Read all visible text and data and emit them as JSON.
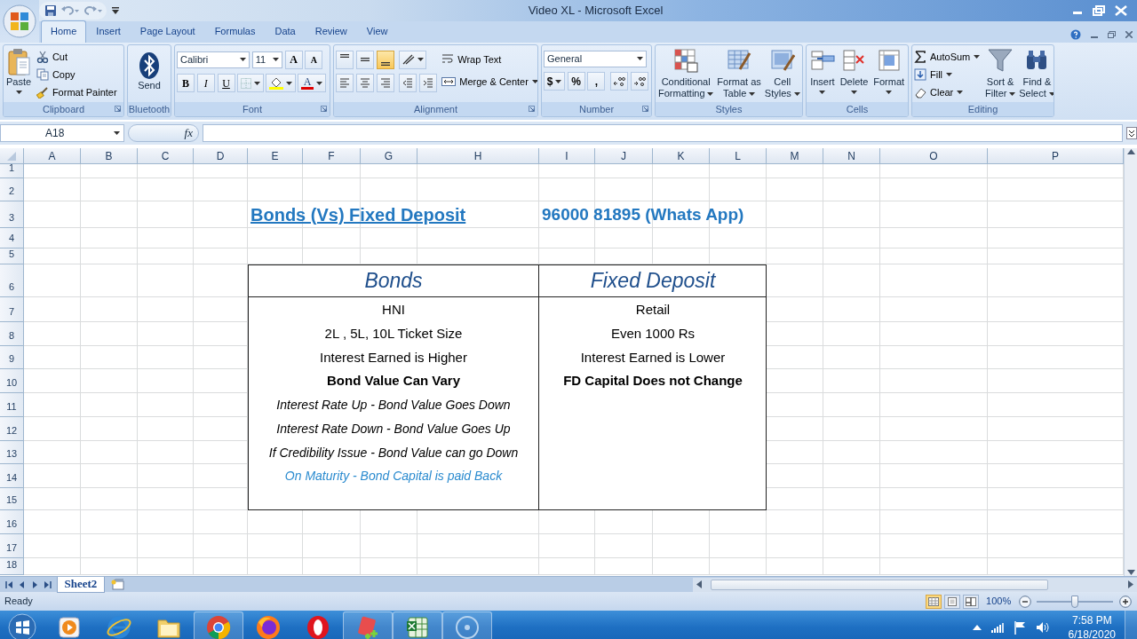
{
  "window": {
    "title": "Video XL - Microsoft Excel"
  },
  "ribbon_tabs": [
    {
      "label": "Home",
      "selected": true
    },
    {
      "label": "Insert",
      "selected": false
    },
    {
      "label": "Page Layout",
      "selected": false
    },
    {
      "label": "Formulas",
      "selected": false
    },
    {
      "label": "Data",
      "selected": false
    },
    {
      "label": "Review",
      "selected": false
    },
    {
      "label": "View",
      "selected": false
    }
  ],
  "ribbon": {
    "clipboard": {
      "label": "Clipboard",
      "paste": "Paste",
      "items": [
        {
          "label": "Cut",
          "kind": "cut"
        },
        {
          "label": "Copy",
          "kind": "copy"
        },
        {
          "label": "Format Painter",
          "kind": "painter"
        }
      ]
    },
    "bluetooth": {
      "label": "Bluetooth",
      "send": "Send"
    },
    "font": {
      "label": "Font",
      "name": "Calibri",
      "size": "11",
      "grow": "A",
      "shrink": "A",
      "styles": [
        "B",
        "I",
        "U"
      ],
      "color_letter": "A"
    },
    "alignment": {
      "label": "Alignment",
      "wrap_text": "Wrap Text",
      "merge_center": "Merge & Center",
      "vertical": [
        {
          "selected": false
        },
        {
          "selected": false
        },
        {
          "selected": true
        }
      ]
    },
    "number": {
      "label": "Number",
      "format": "General",
      "symbols": [
        "$",
        "%",
        ","
      ]
    },
    "styles": {
      "label": "Styles",
      "buttons": [
        {
          "lines": [
            "Conditional",
            "Formatting"
          ],
          "kind": "conditional"
        },
        {
          "lines": [
            "Format as",
            "Table"
          ],
          "kind": "table"
        },
        {
          "lines": [
            "Cell",
            "Styles"
          ],
          "kind": "cellstyles"
        }
      ]
    },
    "cells": {
      "label": "Cells",
      "buttons": [
        {
          "lines": [
            "Insert"
          ],
          "kind": "insert"
        },
        {
          "lines": [
            "Delete"
          ],
          "kind": "delete"
        },
        {
          "lines": [
            "Format"
          ],
          "kind": "format"
        }
      ]
    },
    "editing": {
      "label": "Editing",
      "items": [
        {
          "label": "AutoSum",
          "kind": "sigma"
        },
        {
          "label": "Fill",
          "kind": "fill"
        },
        {
          "label": "Clear",
          "kind": "eraser"
        }
      ],
      "buttons": [
        {
          "lines": [
            "Sort &",
            "Filter"
          ],
          "kind": "sort"
        },
        {
          "lines": [
            "Find &",
            "Select"
          ],
          "kind": "find"
        }
      ]
    }
  },
  "formula_bar": {
    "name_box": "A18",
    "fx": "fx"
  },
  "sheet": {
    "columns": [
      "A",
      "B",
      "C",
      "D",
      "E",
      "F",
      "G",
      "H",
      "I",
      "J",
      "K",
      "L",
      "M",
      "N",
      "O",
      "P"
    ],
    "rows": [
      "1",
      "2",
      "3",
      "4",
      "5",
      "6",
      "7",
      "8",
      "9",
      "10",
      "11",
      "12",
      "13",
      "14",
      "15",
      "16",
      "17",
      "18"
    ],
    "title": "Bonds (Vs) Fixed Deposit",
    "contact": "96000 81895 (Whats App)",
    "table": {
      "headers": [
        "Bonds",
        "Fixed Deposit"
      ],
      "left": [
        {
          "text": "HNI",
          "kind": "normal"
        },
        {
          "text": "2L , 5L, 10L Ticket Size",
          "kind": "normal"
        },
        {
          "text": "Interest Earned is Higher",
          "kind": "normal"
        },
        {
          "text": "Bond Value Can Vary",
          "kind": "bold"
        },
        {
          "text": "Interest Rate Up - Bond Value Goes Down",
          "kind": "italic"
        },
        {
          "text": "Interest Rate Down - Bond Value Goes Up",
          "kind": "italic"
        },
        {
          "text": "If Credibility Issue - Bond Value can go Down",
          "kind": "italic"
        },
        {
          "text": "On Maturity - Bond Capital is paid Back",
          "kind": "link"
        }
      ],
      "right": [
        {
          "text": "Retail",
          "kind": "normal"
        },
        {
          "text": "Even 1000 Rs",
          "kind": "normal"
        },
        {
          "text": "Interest Earned is Lower",
          "kind": "normal"
        },
        {
          "text": "FD Capital Does not Change",
          "kind": "bold"
        }
      ]
    }
  },
  "sheet_tabs": [
    {
      "label": "Sheet2",
      "selected": true
    }
  ],
  "status_bar": {
    "text": "Ready",
    "zoom": "100%",
    "zoom_slider": {
      "level": 0.5
    },
    "views": [
      {
        "kind": "normal",
        "selected": true
      },
      {
        "kind": "layout",
        "selected": false
      },
      {
        "kind": "break",
        "selected": false
      }
    ]
  },
  "taskbar": {
    "apps": [
      {
        "kind": "media",
        "running": false
      },
      {
        "kind": "ie",
        "running": false
      },
      {
        "kind": "folder",
        "running": false
      },
      {
        "kind": "chrome",
        "running": true
      },
      {
        "kind": "firefox",
        "running": false
      },
      {
        "kind": "opera",
        "running": false
      },
      {
        "kind": "notepad",
        "running": true
      },
      {
        "kind": "excel",
        "running": true
      },
      {
        "kind": "disc",
        "running": true
      }
    ],
    "time": "7:58 PM",
    "date": "6/18/2020"
  }
}
